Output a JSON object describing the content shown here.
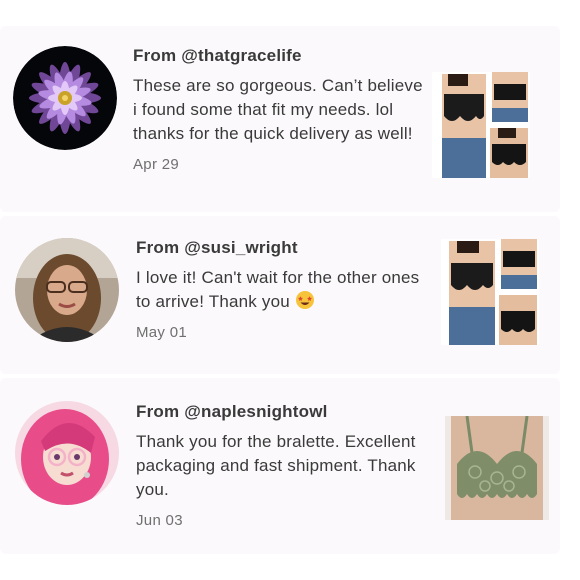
{
  "reviews": [
    {
      "from_prefix": "From ",
      "handle": "@thatgracelife",
      "message": "These are so gorgeous. Can’t believe i found some that fit my needs. lol thanks for the quick delivery as well!",
      "date": "Apr 29",
      "avatar_icon": "dahlia-flower-avatar",
      "product_image": "black-lace-bralette-collage"
    },
    {
      "from_prefix": "From ",
      "handle": "@susi_wright",
      "message": "I love it! Can't wait for the other ones to arrive! Thank you",
      "emoji": "star-struck-emoji",
      "date": "May 01",
      "avatar_icon": "woman-portrait-avatar",
      "product_image": "black-lace-bralette-collage"
    },
    {
      "from_prefix": "From ",
      "handle": "@naplesnightowl",
      "message": "Thank you for the bralette. Excellent packaging and fast shipment. Thank you.",
      "date": "Jun 03",
      "avatar_icon": "pink-hair-cartoon-avatar",
      "product_image": "green-lace-bralette"
    }
  ],
  "colors": {
    "card_background": "#fbf9fb",
    "text": "#3a3a3a",
    "date": "#707070"
  }
}
